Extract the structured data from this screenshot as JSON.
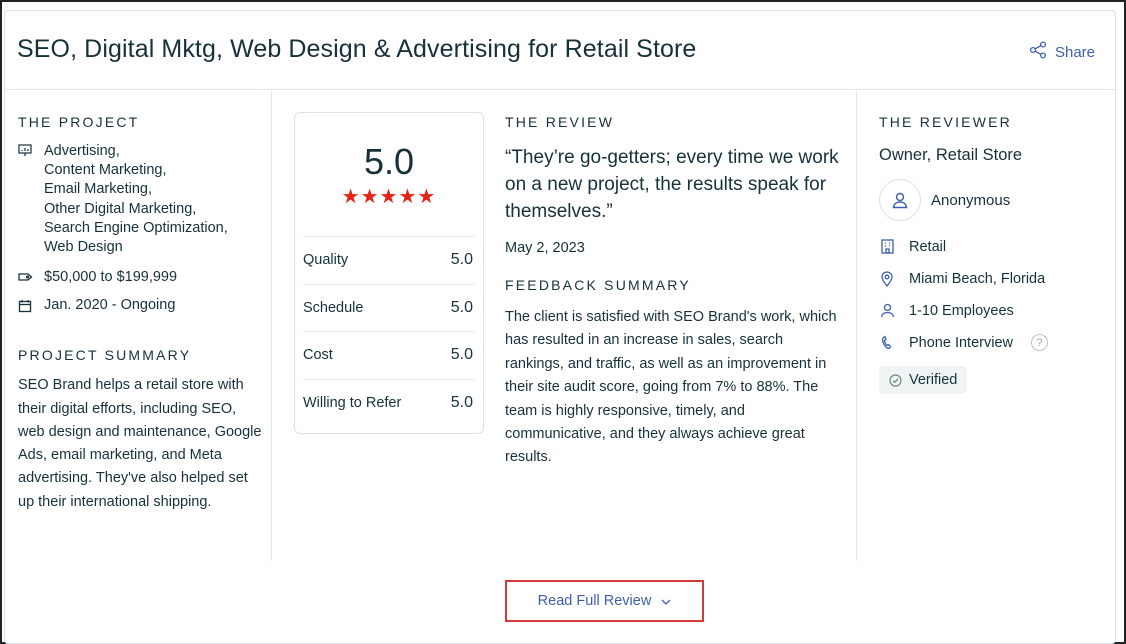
{
  "header": {
    "title": "SEO, Digital Mktg, Web Design & Advertising for Retail Store",
    "share_label": "Share"
  },
  "project": {
    "section_label": "THE PROJECT",
    "services": [
      "Advertising,",
      "Content Marketing,",
      "Email Marketing,",
      "Other Digital Marketing,",
      "Search Engine Optimization,",
      "Web Design"
    ],
    "budget": "$50,000 to $199,999",
    "timeline": "Jan. 2020 - Ongoing",
    "summary_label": "PROJECT SUMMARY",
    "summary_text": "SEO Brand helps a retail store with their digital efforts, including SEO, web design and maintenance, Google Ads, email marketing, and Meta advertising. They've also helped set up their international shipping."
  },
  "rating": {
    "overall": "5.0",
    "stars": "★★★★★",
    "star_count": 5,
    "rows": [
      {
        "label": "Quality",
        "value": "5.0"
      },
      {
        "label": "Schedule",
        "value": "5.0"
      },
      {
        "label": "Cost",
        "value": "5.0"
      },
      {
        "label": "Willing to Refer",
        "value": "5.0"
      }
    ]
  },
  "review": {
    "section_label": "THE REVIEW",
    "quote": "“They’re go-getters; every time we work on a new project, the results speak for themselves.”",
    "date": "May 2, 2023",
    "feedback_label": "FEEDBACK SUMMARY",
    "feedback_text": "The client is satisfied with SEO Brand's work, which has resulted in an increase in sales, search rankings, and traffic, as well as an improvement in their site audit score, going from 7% to 88%. The team is highly responsive, timely, and communicative, and they always achieve great results."
  },
  "reviewer": {
    "section_label": "THE REVIEWER",
    "role": "Owner, Retail Store",
    "name": "Anonymous",
    "industry": "Retail",
    "location": "Miami Beach, Florida",
    "company_size": "1-10 Employees",
    "review_type": "Phone Interview",
    "help_glyph": "?",
    "verified_label": "Verified"
  },
  "actions": {
    "read_full_review": "Read Full Review"
  },
  "colors": {
    "text": "#17313b",
    "link": "#3e5fae",
    "star": "#e62415",
    "button_border": "#d6393a"
  }
}
